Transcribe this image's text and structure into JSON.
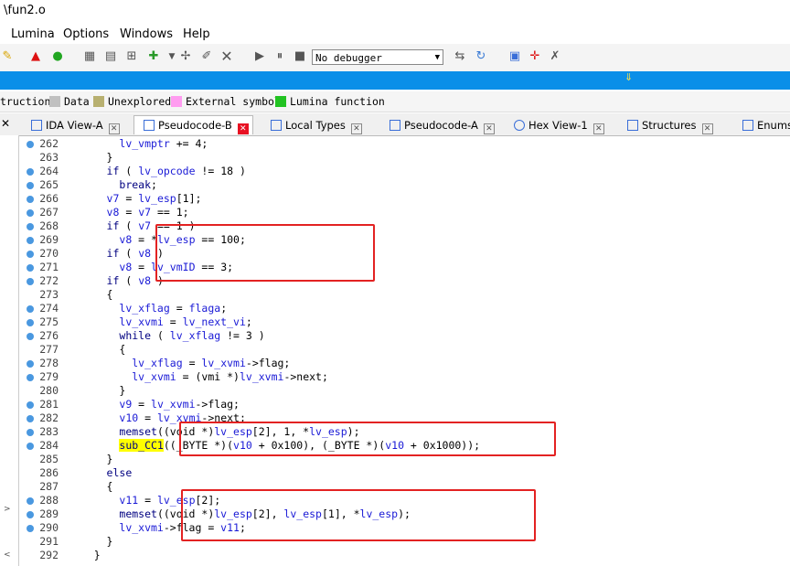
{
  "window": {
    "title": "\\fun2.o"
  },
  "menu": [
    "Lumina",
    "Options",
    "Windows",
    "Help"
  ],
  "debugger_select": "No debugger",
  "legend": [
    {
      "label": "truction",
      "color": ""
    },
    {
      "label": "Data",
      "color": "#c0c0c0"
    },
    {
      "label": "Unexplored",
      "color": "#b8b070"
    },
    {
      "label": "External symbol",
      "color": "#ff9cf0"
    },
    {
      "label": "Lumina function",
      "color": "#22c322"
    }
  ],
  "tabs": [
    {
      "label": "IDA View-A",
      "active": false
    },
    {
      "label": "Pseudocode-B",
      "active": true
    },
    {
      "label": "Local Types",
      "active": false
    },
    {
      "label": "Pseudocode-A",
      "active": false
    },
    {
      "label": "Hex View-1",
      "active": false
    },
    {
      "label": "Structures",
      "active": false
    },
    {
      "label": "Enums",
      "active": false
    }
  ],
  "code_lines": [
    {
      "n": "262",
      "dot": true,
      "text": "        lv_vmptr += 4;"
    },
    {
      "n": "263",
      "dot": false,
      "text": "      }"
    },
    {
      "n": "264",
      "dot": true,
      "text": "      if ( lv_opcode != 18 )"
    },
    {
      "n": "265",
      "dot": true,
      "text": "        break;"
    },
    {
      "n": "266",
      "dot": true,
      "text": "      v7 = lv_esp[1];"
    },
    {
      "n": "267",
      "dot": true,
      "text": "      v8 = v7 == 1;"
    },
    {
      "n": "268",
      "dot": true,
      "text": "      if ( v7 == 1 )"
    },
    {
      "n": "269",
      "dot": true,
      "text": "        v8 = *lv_esp == 100;"
    },
    {
      "n": "270",
      "dot": true,
      "text": "      if ( v8 )"
    },
    {
      "n": "271",
      "dot": true,
      "text": "        v8 = lv_vmID == 3;"
    },
    {
      "n": "272",
      "dot": true,
      "text": "      if ( v8 )"
    },
    {
      "n": "273",
      "dot": false,
      "text": "      {"
    },
    {
      "n": "274",
      "dot": true,
      "text": "        lv_xflag = flaga;"
    },
    {
      "n": "275",
      "dot": true,
      "text": "        lv_xvmi = lv_next_vi;"
    },
    {
      "n": "276",
      "dot": true,
      "text": "        while ( lv_xflag != 3 )"
    },
    {
      "n": "277",
      "dot": false,
      "text": "        {"
    },
    {
      "n": "278",
      "dot": true,
      "text": "          lv_xflag = lv_xvmi->flag;"
    },
    {
      "n": "279",
      "dot": true,
      "text": "          lv_xvmi = (vmi *)lv_xvmi->next;"
    },
    {
      "n": "280",
      "dot": false,
      "text": "        }"
    },
    {
      "n": "281",
      "dot": true,
      "text": "        v9 = lv_xvmi->flag;"
    },
    {
      "n": "282",
      "dot": true,
      "text": "        v10 = lv_xvmi->next;"
    },
    {
      "n": "283",
      "dot": true,
      "text": "        memset((void *)lv_esp[2], 1, *lv_esp);"
    },
    {
      "n": "284",
      "dot": true,
      "text": "        sub_CC1((_BYTE *)(v10 + 0x100), (_BYTE *)(v10 + 0x1000));"
    },
    {
      "n": "285",
      "dot": false,
      "text": "      }"
    },
    {
      "n": "286",
      "dot": false,
      "text": "      else"
    },
    {
      "n": "287",
      "dot": false,
      "text": "      {"
    },
    {
      "n": "288",
      "dot": true,
      "text": "        v11 = lv_esp[2];"
    },
    {
      "n": "289",
      "dot": true,
      "text": "        memset((void *)lv_esp[2], lv_esp[1], *lv_esp);"
    },
    {
      "n": "290",
      "dot": true,
      "text": "        lv_xvmi->flag = v11;"
    },
    {
      "n": "291",
      "dot": false,
      "text": "      }"
    },
    {
      "n": "292",
      "dot": false,
      "text": "    }"
    }
  ]
}
